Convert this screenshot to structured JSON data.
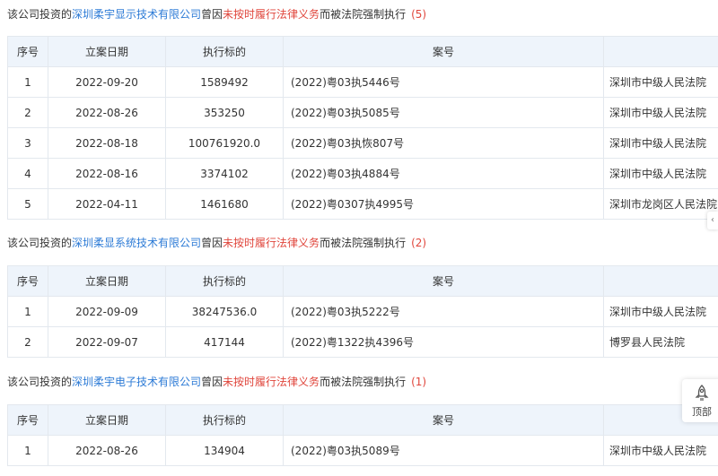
{
  "sections": [
    {
      "prefix": "该公司投资的",
      "company": "深圳柔宇显示技术有限公司",
      "middle": "曾因",
      "reason": "未按时履行法律义务",
      "suffix": "而被法院强制执行",
      "count": "(5)",
      "headers": [
        "序号",
        "立案日期",
        "执行标的",
        "案号",
        ""
      ],
      "rows": [
        [
          "1",
          "2022-09-20",
          "1589492",
          "(2022)粤03执5446号",
          "深圳市中级人民法院"
        ],
        [
          "2",
          "2022-08-26",
          "353250",
          "(2022)粤03执5085号",
          "深圳市中级人民法院"
        ],
        [
          "3",
          "2022-08-18",
          "100761920.0",
          "(2022)粤03执恢807号",
          "深圳市中级人民法院"
        ],
        [
          "4",
          "2022-08-16",
          "3374102",
          "(2022)粤03执4884号",
          "深圳市中级人民法院"
        ],
        [
          "5",
          "2022-04-11",
          "1461680",
          "(2022)粤0307执4995号",
          "深圳市龙岗区人民法院"
        ]
      ]
    },
    {
      "prefix": "该公司投资的",
      "company": "深圳柔显系统技术有限公司",
      "middle": "曾因",
      "reason": "未按时履行法律义务",
      "suffix": "而被法院强制执行",
      "count": "(2)",
      "headers": [
        "序号",
        "立案日期",
        "执行标的",
        "案号",
        ""
      ],
      "rows": [
        [
          "1",
          "2022-09-09",
          "38247536.0",
          "(2022)粤03执5222号",
          "深圳市中级人民法院"
        ],
        [
          "2",
          "2022-09-07",
          "417144",
          "(2022)粤1322执4396号",
          "博罗县人民法院"
        ]
      ]
    },
    {
      "prefix": "该公司投资的",
      "company": "深圳柔宇电子技术有限公司",
      "middle": "曾因",
      "reason": "未按时履行法律义务",
      "suffix": "而被法院强制执行",
      "count": "(1)",
      "headers": [
        "序号",
        "立案日期",
        "执行标的",
        "案号",
        ""
      ],
      "rows": [
        [
          "1",
          "2022-08-26",
          "134904",
          "(2022)粤03执5089号",
          "深圳市中级人民法院"
        ]
      ]
    }
  ],
  "back_to_top": {
    "label": "顶部",
    "icon": "rocket-icon"
  },
  "colors": {
    "link": "#2d7bd6",
    "warning": "#e0463c",
    "header_bg": "#eef4fb",
    "border": "#e3e8ee"
  }
}
